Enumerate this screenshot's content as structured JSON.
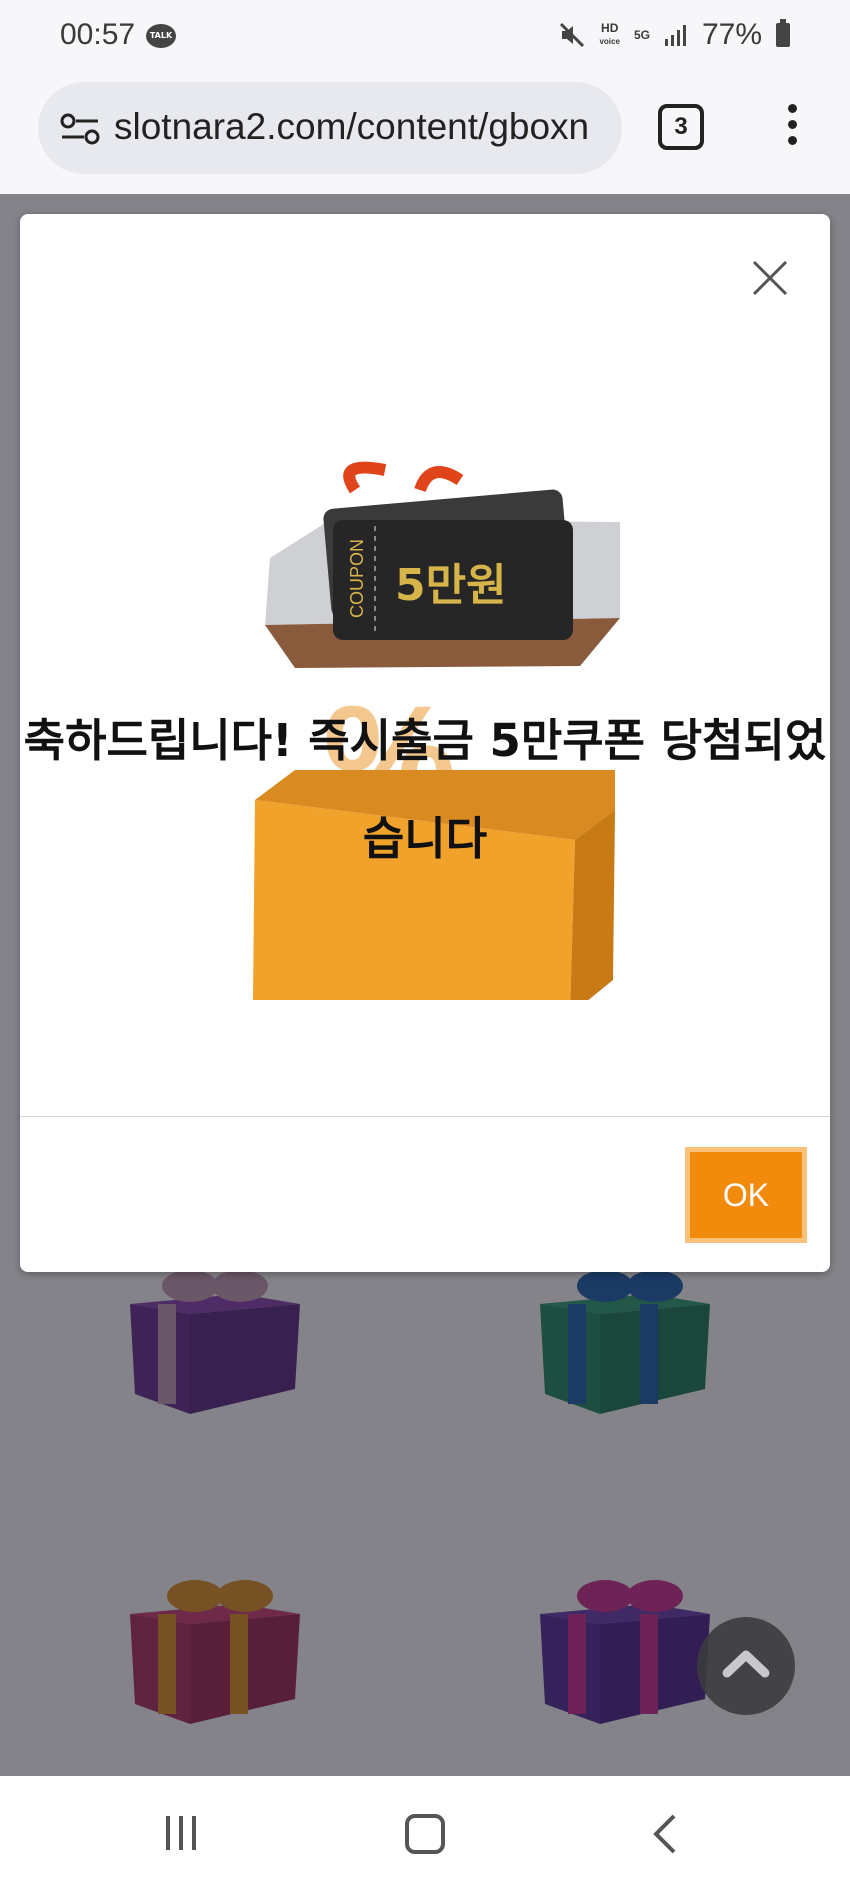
{
  "status_bar": {
    "time": "00:57",
    "talk_label": "TALK",
    "hd_label": "HD",
    "hd_sub": "voice",
    "network": "5G",
    "battery": "77%"
  },
  "browser": {
    "url": "slotnara2.com/content/gboxn",
    "tab_count": "3"
  },
  "modal": {
    "coupon_label": "COUPON",
    "coupon_value": "5만원",
    "message": "축하드립니다! 즉시출금 5만쿠폰 당첨되었습니다",
    "ok_label": "OK"
  },
  "colors": {
    "accent": "#f28a0c",
    "accent_border": "#f8c27a"
  },
  "icons": {
    "close": "close-icon",
    "scroll_top": "chevron-up-icon",
    "menu": "more-vert-icon",
    "site_settings": "tune-icon"
  }
}
